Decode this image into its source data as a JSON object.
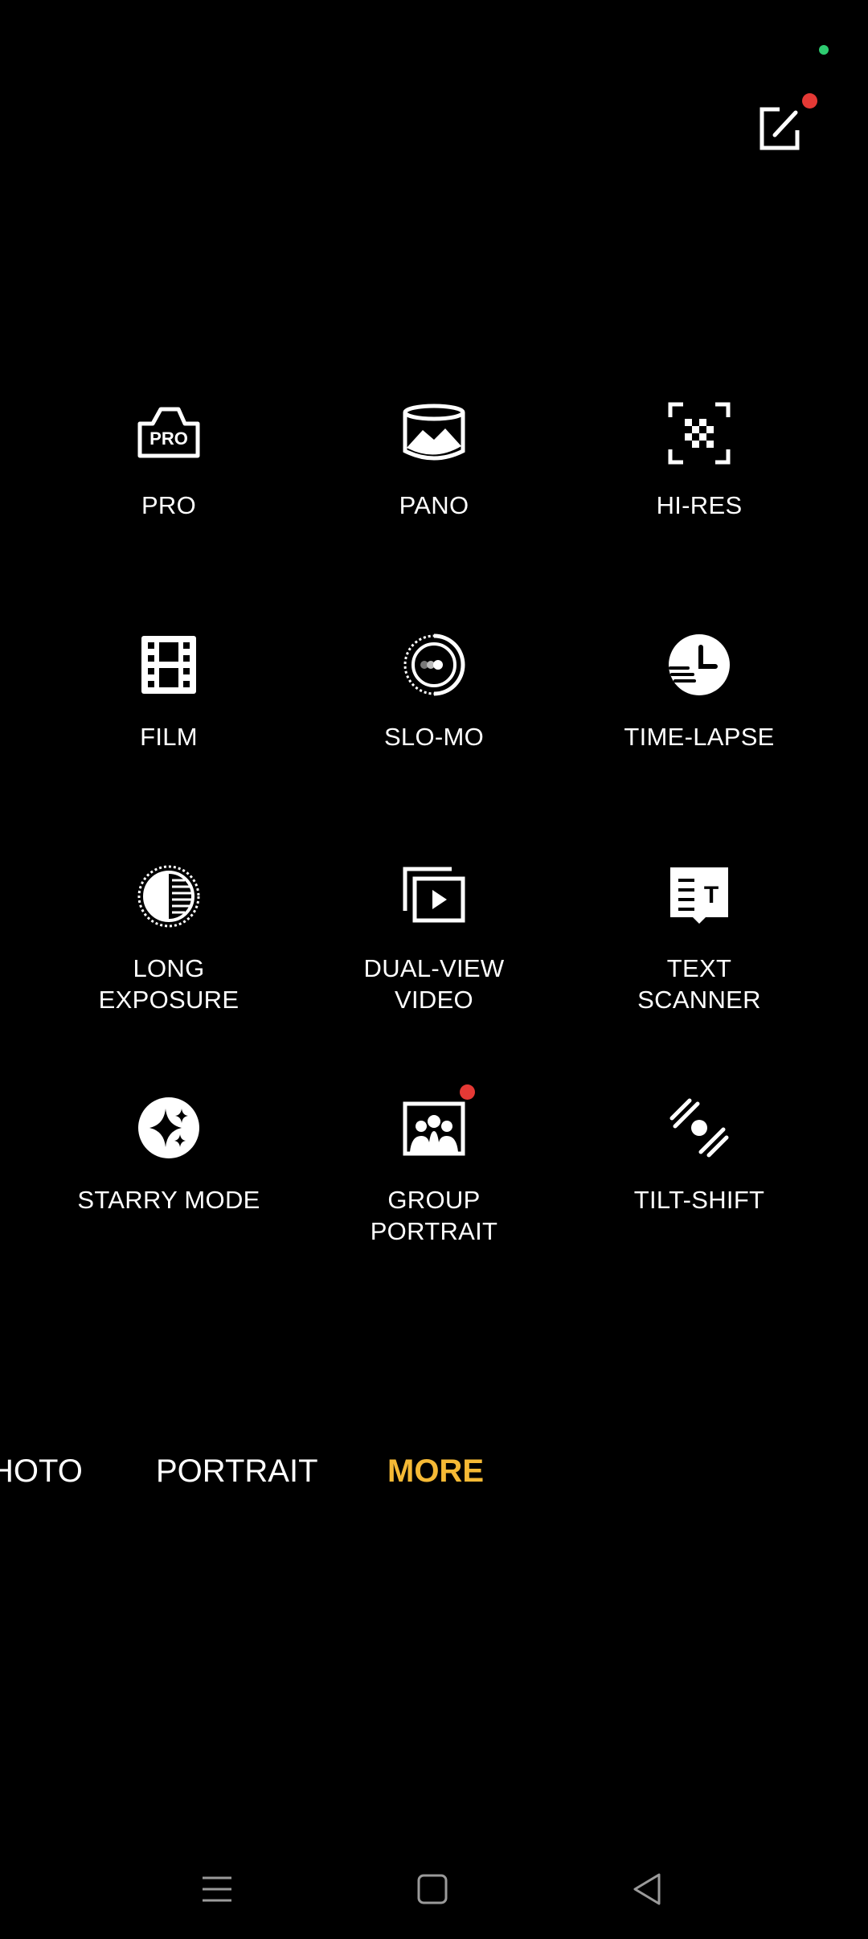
{
  "top": {
    "privacy_indicator_color": "#2ecc71",
    "edit_icon": "edit-icon",
    "edit_has_badge": true
  },
  "modes": [
    {
      "label": "PRO",
      "icon": "pro-camera-icon"
    },
    {
      "label": "PANO",
      "icon": "panorama-icon"
    },
    {
      "label": "HI-RES",
      "icon": "hi-res-icon"
    },
    {
      "label": "FILM",
      "icon": "film-icon"
    },
    {
      "label": "SLO-MO",
      "icon": "slow-motion-icon"
    },
    {
      "label": "TIME-LAPSE",
      "icon": "time-lapse-icon"
    },
    {
      "label": "LONG\nEXPOSURE",
      "icon": "long-exposure-icon"
    },
    {
      "label": "DUAL-VIEW\nVIDEO",
      "icon": "dual-view-video-icon"
    },
    {
      "label": "TEXT\nSCANNER",
      "icon": "text-scanner-icon"
    },
    {
      "label": "STARRY MODE",
      "icon": "starry-mode-icon"
    },
    {
      "label": "GROUP\nPORTRAIT",
      "icon": "group-portrait-icon",
      "badge": true
    },
    {
      "label": "TILT-SHIFT",
      "icon": "tilt-shift-icon"
    }
  ],
  "mode_strip": {
    "items": [
      "HOTO",
      "PORTRAIT",
      "MORE"
    ],
    "active": "MORE",
    "active_color": "#f5b935"
  },
  "badge_color": "#e53935",
  "navbar": {
    "menu_icon": "menu-icon",
    "home_icon": "home-icon",
    "back_icon": "back-icon"
  }
}
